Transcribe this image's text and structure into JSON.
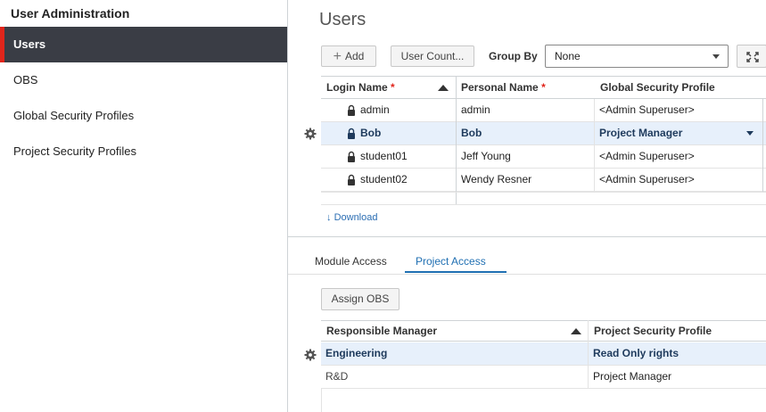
{
  "sidebar": {
    "title": "User Administration",
    "items": [
      {
        "label": "Users",
        "active": true
      },
      {
        "label": "OBS",
        "active": false
      },
      {
        "label": "Global Security Profiles",
        "active": false
      },
      {
        "label": "Project Security Profiles",
        "active": false
      }
    ]
  },
  "main": {
    "title": "Users",
    "toolbar": {
      "add_label": "Add",
      "user_count_label": "User Count...",
      "group_by_label": "Group By",
      "group_by_value": "None"
    },
    "users_grid": {
      "columns": [
        {
          "label": "Login Name",
          "required": "*"
        },
        {
          "label": "Personal Name",
          "required": "*"
        },
        {
          "label": "Global Security Profile"
        }
      ],
      "rows": [
        {
          "login": "admin",
          "name": "admin",
          "profile": "<Admin Superuser>",
          "selected": false
        },
        {
          "login": "Bob",
          "name": "Bob",
          "profile": "Project Manager",
          "selected": true
        },
        {
          "login": "student01",
          "name": "Jeff Young",
          "profile": "<Admin Superuser>",
          "selected": false
        },
        {
          "login": "student02",
          "name": "Wendy Resner",
          "profile": "<Admin Superuser>",
          "selected": false
        }
      ]
    },
    "download_label": "Download",
    "tabs": [
      {
        "label": "Module Access",
        "active": false
      },
      {
        "label": "Project Access",
        "active": true
      }
    ],
    "assign_obs_label": "Assign OBS",
    "access_grid": {
      "columns": [
        {
          "label": "Responsible Manager"
        },
        {
          "label": "Project Security Profile"
        }
      ],
      "rows": [
        {
          "manager": "Engineering",
          "profile": "Read Only rights",
          "selected": true
        },
        {
          "manager": "R&D",
          "profile": "Project Manager",
          "selected": false
        }
      ]
    }
  },
  "colors": {
    "accent": "#1f6fb2",
    "sidebar_active_bg": "#3a3d45",
    "sidebar_active_marker": "#e1251b",
    "selected_row_bg": "#e7f0fb"
  },
  "icons": {
    "add": "plus-icon",
    "lock": "lock-icon",
    "gear": "gear-icon",
    "download": "arrow-down-icon",
    "expand": "expand-icon"
  }
}
